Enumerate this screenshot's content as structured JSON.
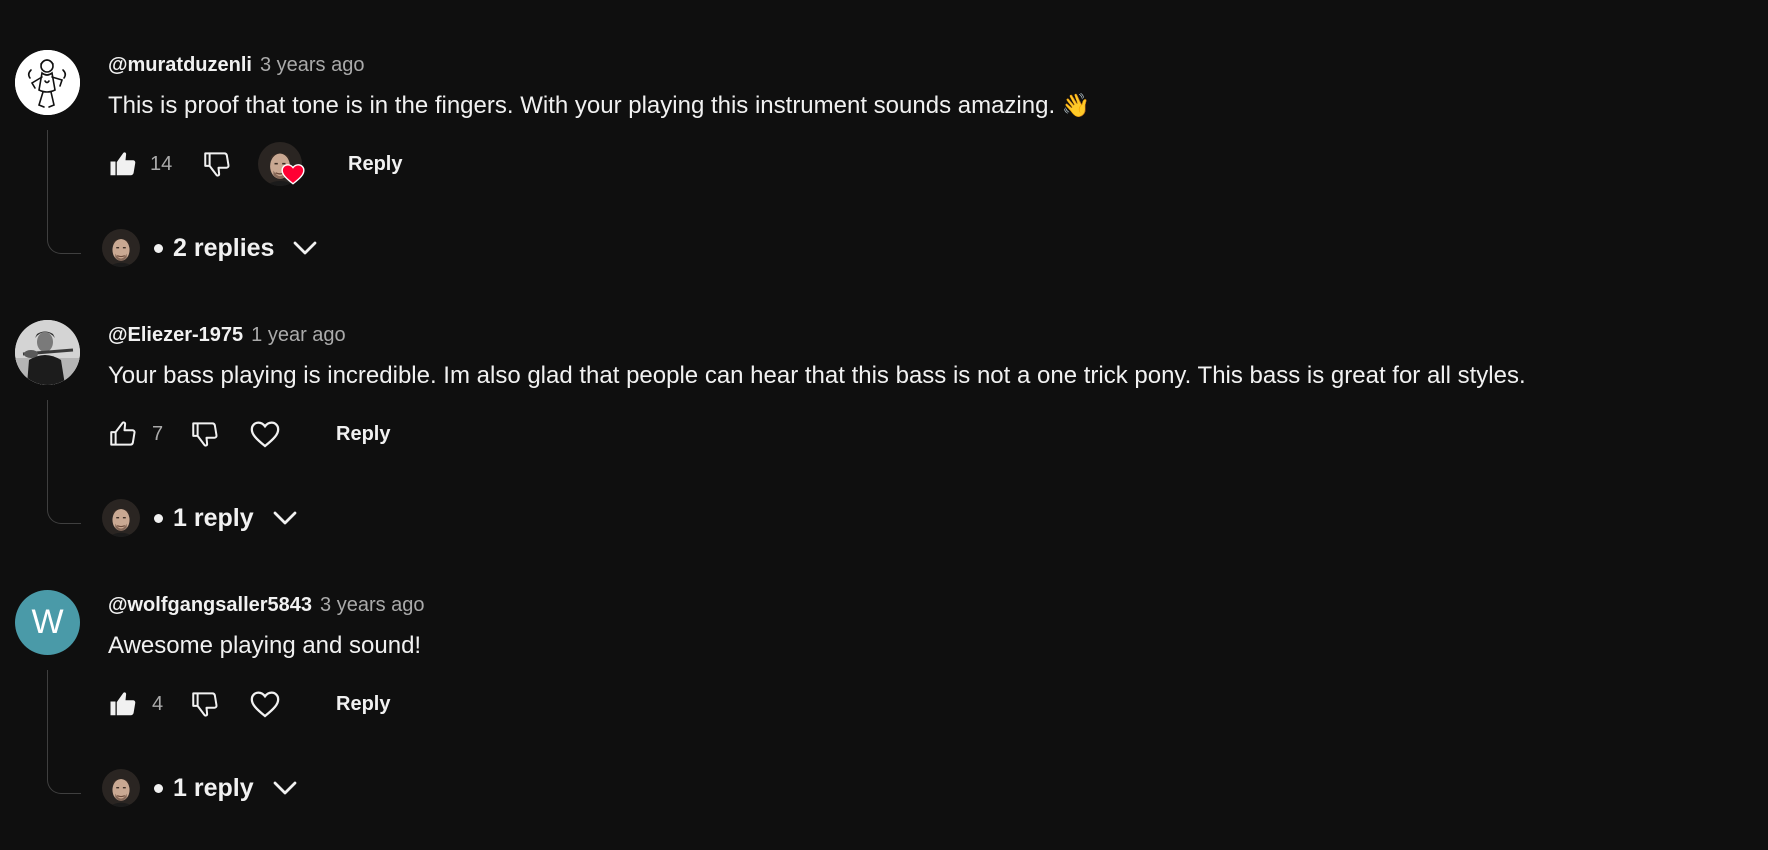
{
  "comments": [
    {
      "avatar_icon": "illustrated-figure-avatar",
      "author": "@muratduzenli",
      "time": "3 years ago",
      "text": "This is proof that tone is in the fingers. With your playing this instrument sounds amazing.",
      "emoji": "👋",
      "likes": "14",
      "liked": true,
      "creator_hearted": true,
      "reply_label": "Reply",
      "replies_label": "2 replies"
    },
    {
      "avatar_icon": "person-with-violin-photo-avatar",
      "author": "@Eliezer-1975",
      "time": "1 year ago",
      "text": "Your bass playing is incredible. Im also glad that people can hear that this bass is not a one trick pony. This bass is great for all styles.",
      "likes": "7",
      "liked": false,
      "creator_hearted": false,
      "reply_label": "Reply",
      "replies_label": "1 reply"
    },
    {
      "avatar_letter": "W",
      "avatar_color": "#4a9aa8",
      "author": "@wolfgangsaller5843",
      "time": "3 years ago",
      "text": "Awesome playing and sound!",
      "likes": "4",
      "liked": true,
      "creator_hearted": false,
      "reply_label": "Reply",
      "replies_label": "1 reply"
    }
  ],
  "colors": {
    "background": "#0f0f0f",
    "text": "#f1f1f1",
    "secondary_text": "#aaaaaa",
    "heart_red": "#ff0033"
  }
}
